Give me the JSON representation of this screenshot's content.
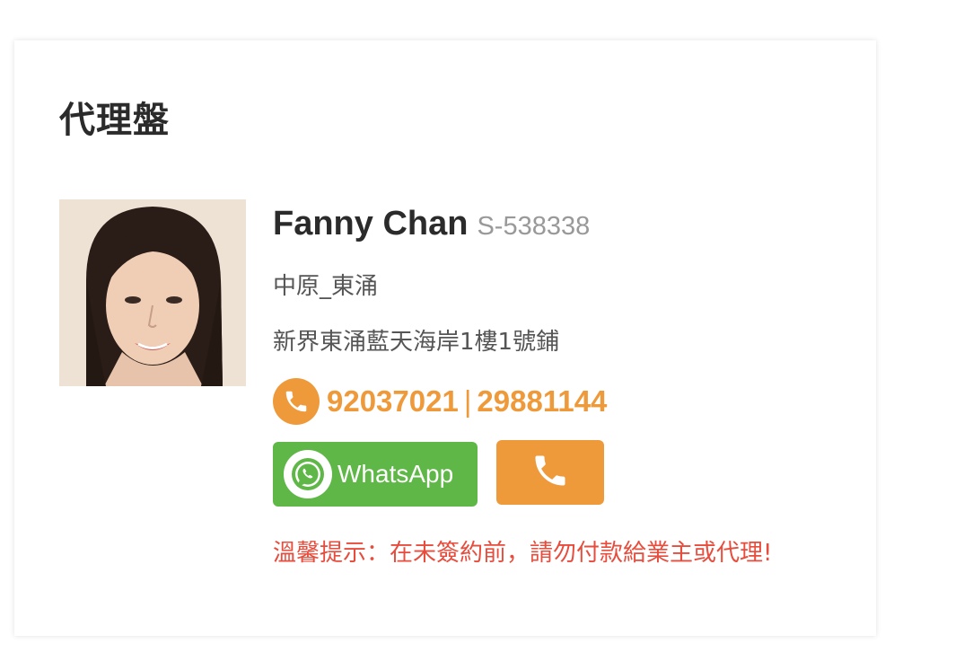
{
  "section": {
    "title": "代理盤"
  },
  "agent": {
    "name": "Fanny Chan",
    "license": "S-538338",
    "agency": "中原_東涌",
    "address": "新界東涌藍天海岸1樓1號鋪",
    "phones": [
      "92037021",
      "29881144"
    ],
    "phone_separator": "|",
    "avatar_icon": "agent-photo"
  },
  "actions": {
    "whatsapp_label": "WhatsApp",
    "whatsapp_icon": "whatsapp-icon",
    "call_icon": "phone-icon"
  },
  "warning": "溫馨提示：在未簽約前，請勿付款給業主或代理!",
  "colors": {
    "accent_orange": "#ef9a3a",
    "whatsapp_green": "#5fb747",
    "warning_red": "#e74c3c",
    "title_text": "#2b2b2b",
    "muted_text": "#999999"
  }
}
